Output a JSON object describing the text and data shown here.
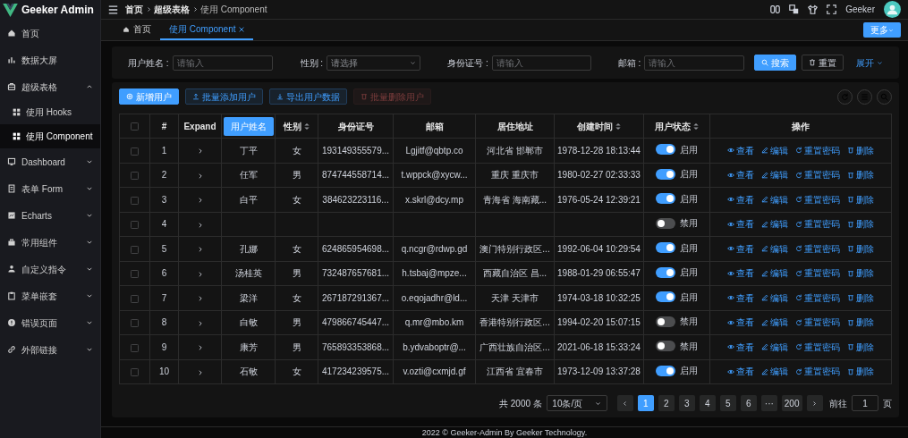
{
  "logo": {
    "title": "Geeker Admin"
  },
  "sidebar": {
    "items": [
      {
        "label": "首页",
        "selected": false
      },
      {
        "label": "数据大屏",
        "selected": false
      },
      {
        "label": "超级表格",
        "selected": false,
        "expanded": true,
        "children": [
          {
            "label": "使用 Hooks",
            "selected": false
          },
          {
            "label": "使用 Component",
            "selected": true
          }
        ]
      },
      {
        "label": "Dashboard",
        "selected": false,
        "expanded": false
      },
      {
        "label": "表单 Form",
        "selected": false,
        "expanded": false
      },
      {
        "label": "Echarts",
        "selected": false,
        "expanded": false
      },
      {
        "label": "常用组件",
        "selected": false,
        "expanded": false
      },
      {
        "label": "自定义指令",
        "selected": false,
        "expanded": false
      },
      {
        "label": "菜单嵌套",
        "selected": false,
        "expanded": false
      },
      {
        "label": "错误页面",
        "selected": false,
        "expanded": false
      },
      {
        "label": "外部链接",
        "selected": false,
        "expanded": false
      }
    ]
  },
  "breadcrumb": [
    "首页",
    "超级表格",
    "使用 Component"
  ],
  "header": {
    "username": "Geeker"
  },
  "tabs": [
    {
      "label": "首页",
      "selected": false,
      "closable": false
    },
    {
      "label": "使用 Component",
      "selected": true,
      "closable": true
    }
  ],
  "more_button": "更多",
  "search": {
    "fields": [
      {
        "label": "用户姓名 :",
        "placeholder": "请输入",
        "kind": "input"
      },
      {
        "label": "性别 :",
        "placeholder": "请选择",
        "kind": "select"
      },
      {
        "label": "身份证号 :",
        "placeholder": "请输入",
        "kind": "input"
      },
      {
        "label": "邮箱 :",
        "placeholder": "请输入",
        "kind": "input"
      }
    ],
    "buttons": [
      {
        "label": "搜索",
        "kind": "primary"
      },
      {
        "label": "重置",
        "kind": "default"
      },
      {
        "label": "展开",
        "kind": "link"
      }
    ]
  },
  "toolbar": [
    {
      "label": "新增用户",
      "kind": "primary",
      "disabled": false
    },
    {
      "label": "批量添加用户",
      "kind": "plain",
      "disabled": false
    },
    {
      "label": "导出用户数据",
      "kind": "plain",
      "disabled": false
    },
    {
      "label": "批量删除用户",
      "kind": "danger",
      "disabled": true
    }
  ],
  "table": {
    "columns": [
      {
        "kind": "checkbox",
        "checked": false
      },
      {
        "kind": "text",
        "label": "#",
        "sortable": false
      },
      {
        "kind": "text",
        "label": "Expand",
        "sortable": false
      },
      {
        "kind": "button",
        "label": "用户姓名"
      },
      {
        "kind": "text",
        "label": "性别",
        "sortable": true
      },
      {
        "kind": "text",
        "label": "身份证号",
        "sortable": false
      },
      {
        "kind": "text",
        "label": "邮箱",
        "sortable": false
      },
      {
        "kind": "text",
        "label": "居住地址",
        "sortable": false
      },
      {
        "kind": "text",
        "label": "创建时间",
        "sortable": true
      },
      {
        "kind": "text",
        "label": "用户状态",
        "sortable": true
      },
      {
        "kind": "text",
        "label": "操作",
        "sortable": false
      }
    ],
    "rows": [
      {
        "checked": false,
        "index": "1",
        "name": "丁平",
        "gender": "女",
        "id_number": "193149355579...",
        "email": "Lgjitf@qbtp.co",
        "address": "河北省 邯郸市",
        "created": "1978-12-28 18:13:44",
        "status": {
          "enabled": true,
          "label": "启用"
        },
        "actions": [
          "查看",
          "编辑",
          "重置密码",
          "删除"
        ]
      },
      {
        "checked": false,
        "index": "2",
        "name": "任军",
        "gender": "男",
        "id_number": "874744558714...",
        "email": "t.wppck@xycw...",
        "address": "重庆 重庆市",
        "created": "1980-02-27 02:33:33",
        "status": {
          "enabled": true,
          "label": "启用"
        },
        "actions": [
          "查看",
          "编辑",
          "重置密码",
          "删除"
        ]
      },
      {
        "checked": false,
        "index": "3",
        "name": "白平",
        "gender": "女",
        "id_number": "384623223116...",
        "email": "x.skrl@dcy.mp",
        "address": "青海省 海南藏...",
        "created": "1976-05-24 12:39:21",
        "status": {
          "enabled": true,
          "label": "启用"
        },
        "actions": [
          "查看",
          "编辑",
          "重置密码",
          "删除"
        ]
      },
      {
        "checked": false,
        "index": "4",
        "status": {
          "enabled": false,
          "label": "禁用"
        },
        "actions": [
          "查看",
          "编辑",
          "重置密码",
          "删除"
        ]
      },
      {
        "checked": false,
        "index": "5",
        "name": "孔娜",
        "gender": "女",
        "id_number": "624865954698...",
        "email": "q.ncgr@rdwp.gd",
        "address": "澳门特别行政区...",
        "created": "1992-06-04 10:29:54",
        "status": {
          "enabled": true,
          "label": "启用"
        },
        "actions": [
          "查看",
          "编辑",
          "重置密码",
          "删除"
        ]
      },
      {
        "checked": false,
        "index": "6",
        "name": "汤桂英",
        "gender": "男",
        "id_number": "732487657681...",
        "email": "h.tsbaj@mpze...",
        "address": "西藏自治区 昌...",
        "created": "1988-01-29 06:55:47",
        "status": {
          "enabled": true,
          "label": "启用"
        },
        "actions": [
          "查看",
          "编辑",
          "重置密码",
          "删除"
        ]
      },
      {
        "checked": false,
        "index": "7",
        "name": "梁洋",
        "gender": "女",
        "id_number": "267187291367...",
        "email": "o.eqojadhr@ld...",
        "address": "天津 天津市",
        "created": "1974-03-18 10:32:25",
        "status": {
          "enabled": true,
          "label": "启用"
        },
        "actions": [
          "查看",
          "编辑",
          "重置密码",
          "删除"
        ]
      },
      {
        "checked": false,
        "index": "8",
        "name": "白敏",
        "gender": "男",
        "id_number": "479866745447...",
        "email": "q.mr@mbo.km",
        "address": "香港特别行政区...",
        "created": "1994-02-20 15:07:15",
        "status": {
          "enabled": false,
          "label": "禁用"
        },
        "actions": [
          "查看",
          "编辑",
          "重置密码",
          "删除"
        ]
      },
      {
        "checked": false,
        "index": "9",
        "name": "康芳",
        "gender": "男",
        "id_number": "765893353868...",
        "email": "b.ydvaboptr@...",
        "address": "广西壮族自治区...",
        "created": "2021-06-18 15:33:24",
        "status": {
          "enabled": false,
          "label": "禁用"
        },
        "actions": [
          "查看",
          "编辑",
          "重置密码",
          "删除"
        ]
      },
      {
        "checked": false,
        "index": "10",
        "name": "石敏",
        "gender": "女",
        "id_number": "417234239575...",
        "email": "v.ozti@cxmjd.gf",
        "address": "江西省 宜春市",
        "created": "1973-12-09 13:37:28",
        "status": {
          "enabled": true,
          "label": "启用"
        },
        "actions": [
          "查看",
          "编辑",
          "重置密码",
          "删除"
        ]
      }
    ]
  },
  "pagination": {
    "total": "共 2000 条",
    "page_size": "10条/页",
    "pages": [
      {
        "label": "1",
        "selected": true
      },
      {
        "label": "2",
        "selected": false
      },
      {
        "label": "3",
        "selected": false
      },
      {
        "label": "4",
        "selected": false
      },
      {
        "label": "5",
        "selected": false
      },
      {
        "label": "6",
        "selected": false
      },
      {
        "label": "···",
        "selected": false
      },
      {
        "label": "200",
        "selected": false
      }
    ],
    "jump_label": "前往",
    "jump_value": "1",
    "jump_suffix": "页"
  },
  "footer": "2022 © Geeker-Admin By Geeker Technology."
}
